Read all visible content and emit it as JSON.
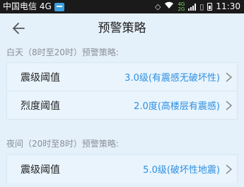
{
  "status_bar": {
    "carrier": "中国电信 4G",
    "network": "4G",
    "time": "11:30"
  },
  "header": {
    "title": "预警策略"
  },
  "sections": [
    {
      "title": "白天（8时至20时）预警策略:",
      "items": [
        {
          "label": "震级阈值",
          "value": "3.0级(有震感无破坏性)"
        },
        {
          "label": "烈度阈值",
          "value": "2.0度(高楼层有震感)"
        }
      ]
    },
    {
      "title": "夜间（20时至8时）预警策略:",
      "items": [
        {
          "label": "震级阈值",
          "value": "5.0级(破坏性地震)"
        }
      ]
    }
  ],
  "colors": {
    "background": "#e4f0fa",
    "accent": "#2e8fe0",
    "status_bar": "#1a1a1a"
  }
}
